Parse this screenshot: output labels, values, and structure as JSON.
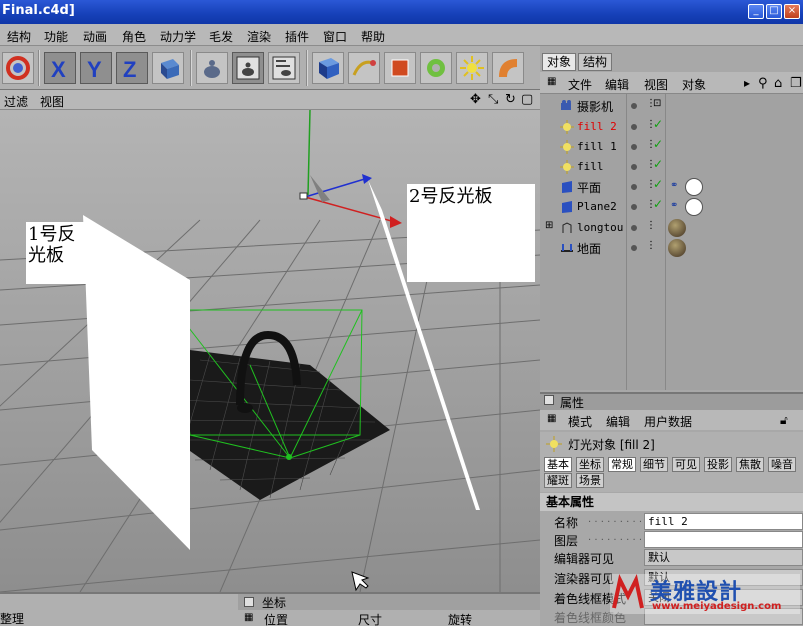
{
  "window": {
    "title": "Final.c4d]"
  },
  "menu": [
    "结构",
    "功能",
    "动画",
    "角色",
    "动力学",
    "毛发",
    "渲染",
    "插件",
    "窗口",
    "帮助"
  ],
  "toolbar": {
    "axis_x": "X",
    "axis_y": "Y",
    "axis_z": "Z"
  },
  "viewport": {
    "menu": [
      "过滤",
      "视图"
    ],
    "label_board1": "1号反\n光板",
    "label_board2": "2号反光板"
  },
  "object_manager": {
    "tabs": [
      "对象",
      "结构"
    ],
    "menu": [
      "文件",
      "编辑",
      "视图",
      "对象"
    ],
    "objects": [
      {
        "name": "摄影机",
        "type": "camera"
      },
      {
        "name": "fill 2",
        "type": "light",
        "selected": true
      },
      {
        "name": "fill 1",
        "type": "light"
      },
      {
        "name": "fill",
        "type": "light"
      },
      {
        "name": "平面",
        "type": "plane"
      },
      {
        "name": "Plane2",
        "type": "plane"
      },
      {
        "name": "longtou",
        "type": "object"
      },
      {
        "name": "地面",
        "type": "floor"
      }
    ]
  },
  "attributes": {
    "header": "属性",
    "menu": [
      "模式",
      "编辑",
      "用户数据"
    ],
    "title": "灯光对象 [fill 2]",
    "tabs_row1": [
      "基本",
      "坐标",
      "常规",
      "细节",
      "可见",
      "投影",
      "焦散",
      "噪音"
    ],
    "tabs_row2": [
      "耀斑",
      "场景"
    ],
    "section": "基本属性",
    "props": [
      {
        "label": "名称",
        "value": "fill 2"
      },
      {
        "label": "图层",
        "value": ""
      },
      {
        "label": "编辑器可见",
        "value": "默认"
      },
      {
        "label": "渲染器可见",
        "value": "默认"
      },
      {
        "label": "着色线框模式",
        "value": "关闭"
      },
      {
        "label": "着色线框颜色",
        "value": ""
      }
    ]
  },
  "bottom": {
    "left_label": "整理",
    "coord_header": "坐标",
    "cols": [
      "位置",
      "尺寸",
      "旋转"
    ]
  },
  "watermark": {
    "brand": "美雅設計",
    "url": "www.meiyadesign.com"
  }
}
